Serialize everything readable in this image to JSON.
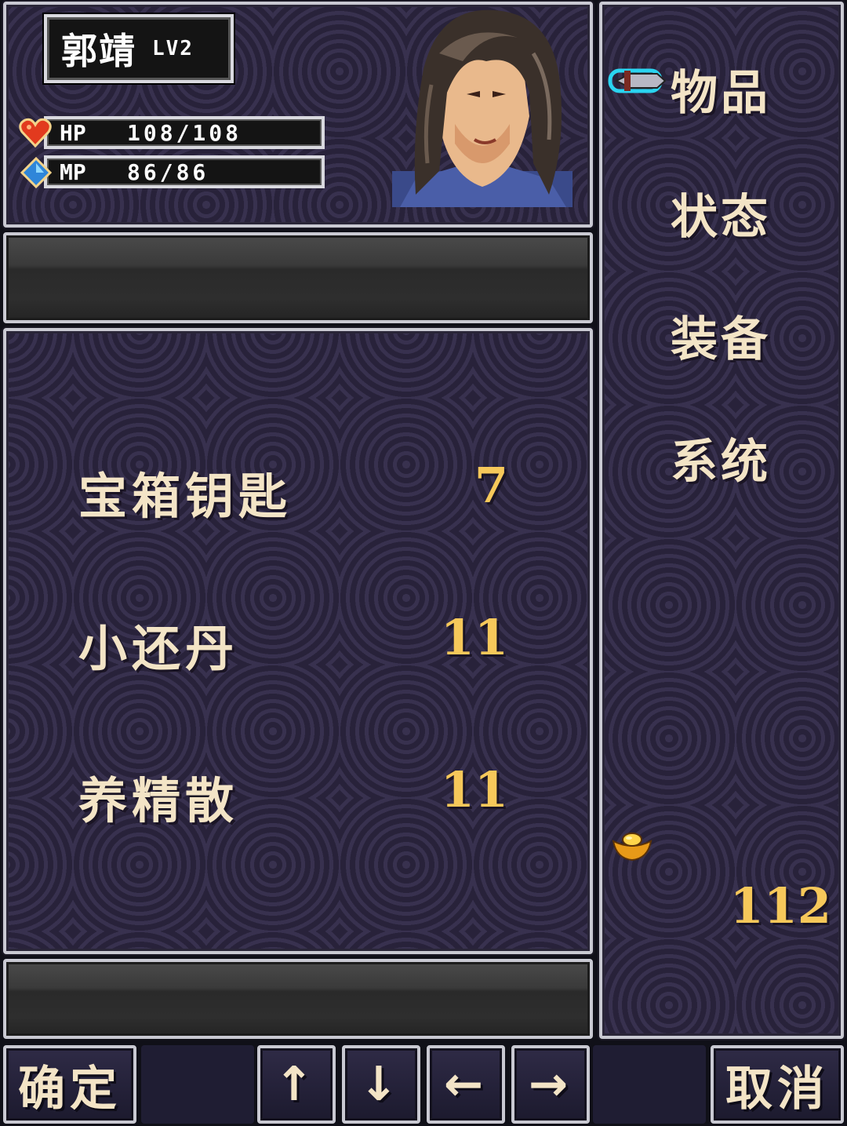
{
  "character": {
    "name": "郭靖",
    "level": "LV2",
    "hp_label": "HP",
    "hp": "108/108",
    "mp_label": "MP",
    "mp": "86/86"
  },
  "menu": {
    "items": [
      "物品",
      "状态",
      "装备",
      "系统"
    ],
    "selected": "物品"
  },
  "inventory": {
    "items": [
      {
        "name": "宝箱钥匙",
        "qty": "7"
      },
      {
        "name": "小还丹",
        "qty": "11"
      },
      {
        "name": "养精散",
        "qty": "11"
      }
    ]
  },
  "gold": "112",
  "buttons": {
    "confirm": "确定",
    "up": "↑",
    "down": "↓",
    "left": "←",
    "right": "→",
    "cancel": "取消"
  },
  "colors": {
    "panel_bg": "#28223a",
    "border": "#c9c9d2",
    "text": "#f3e4c6",
    "number": "#f6c85a",
    "cursor": "#2ad4f0"
  },
  "icons": {
    "hp": "heart-icon",
    "mp": "diamond-icon",
    "cursor": "sword-cursor-icon",
    "gold": "gold-ingot-icon"
  }
}
